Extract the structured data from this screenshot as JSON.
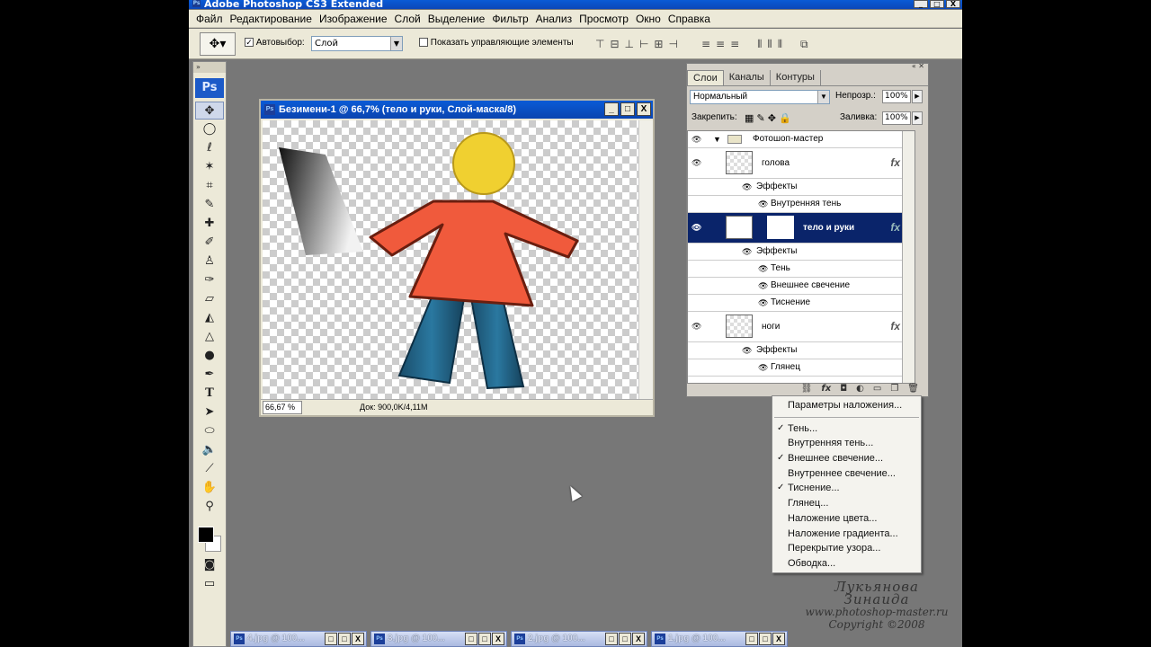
{
  "app": {
    "title": "Adobe Photoshop CS3 Extended",
    "logo": "Ps",
    "window_buttons": [
      "_",
      "□",
      "X"
    ]
  },
  "menu": [
    "Файл",
    "Редактирование",
    "Изображение",
    "Слой",
    "Выделение",
    "Фильтр",
    "Анализ",
    "Просмотр",
    "Окно",
    "Справка"
  ],
  "options": {
    "autoselect_label": "Автовыбор:",
    "autoselect_value": "Слой",
    "show_controls_label": "Показать управляющие элементы",
    "checkmark": "✓"
  },
  "document": {
    "title": "Безимени-1 @ 66,7% (тело и руки, Слой-маска/8)",
    "zoom": "66,67 %",
    "info": "Док: 900,0K/4,11M"
  },
  "layers_panel": {
    "tabs": [
      "Слои",
      "Каналы",
      "Контуры"
    ],
    "blend_mode": "Нормальный",
    "opacity_label": "Непрозр.:",
    "opacity": "100%",
    "lock_label": "Закрепить:",
    "fill_label": "Заливка:",
    "fill": "100%",
    "group": "Фотошоп-мастер",
    "layer_head": "голова",
    "effects_label": "Эффекты",
    "head_effect": "Внутренняя тень",
    "layer_body": "тело и руки",
    "body_effects": [
      "Тень",
      "Внешнее свечение",
      "Тиснение"
    ],
    "layer_legs": "ноги",
    "legs_effect": "Глянец",
    "fx": "fx"
  },
  "context_menu": {
    "top": "Параметры наложения...",
    "items": [
      {
        "label": "Тень...",
        "checked": true
      },
      {
        "label": "Внутренняя тень...",
        "checked": false
      },
      {
        "label": "Внешнее свечение...",
        "checked": true
      },
      {
        "label": "Внутреннее свечение...",
        "checked": false
      },
      {
        "label": "Тиснение...",
        "checked": true
      },
      {
        "label": "Глянец...",
        "checked": false
      },
      {
        "label": "Наложение цвета...",
        "checked": false
      },
      {
        "label": "Наложение градиента...",
        "checked": false
      },
      {
        "label": "Перекрытие узора...",
        "checked": false
      },
      {
        "label": "Обводка...",
        "checked": false
      }
    ]
  },
  "watermark": {
    "name": "Лукьянова Зинаида",
    "url": "www.photoshop-master.ru",
    "copyright": "Copyright ©2008"
  },
  "taskbar": [
    "4.jpg @ 100...",
    "3.jpg @ 100...",
    "2.jpg @ 100...",
    "1.jpg @ 100..."
  ],
  "colors": {
    "title_blue": "#0a5bd6",
    "selected_layer": "#0a246a",
    "shirt": "#f05a3c",
    "head": "#f0d030",
    "legs": "#1e5a7a"
  }
}
